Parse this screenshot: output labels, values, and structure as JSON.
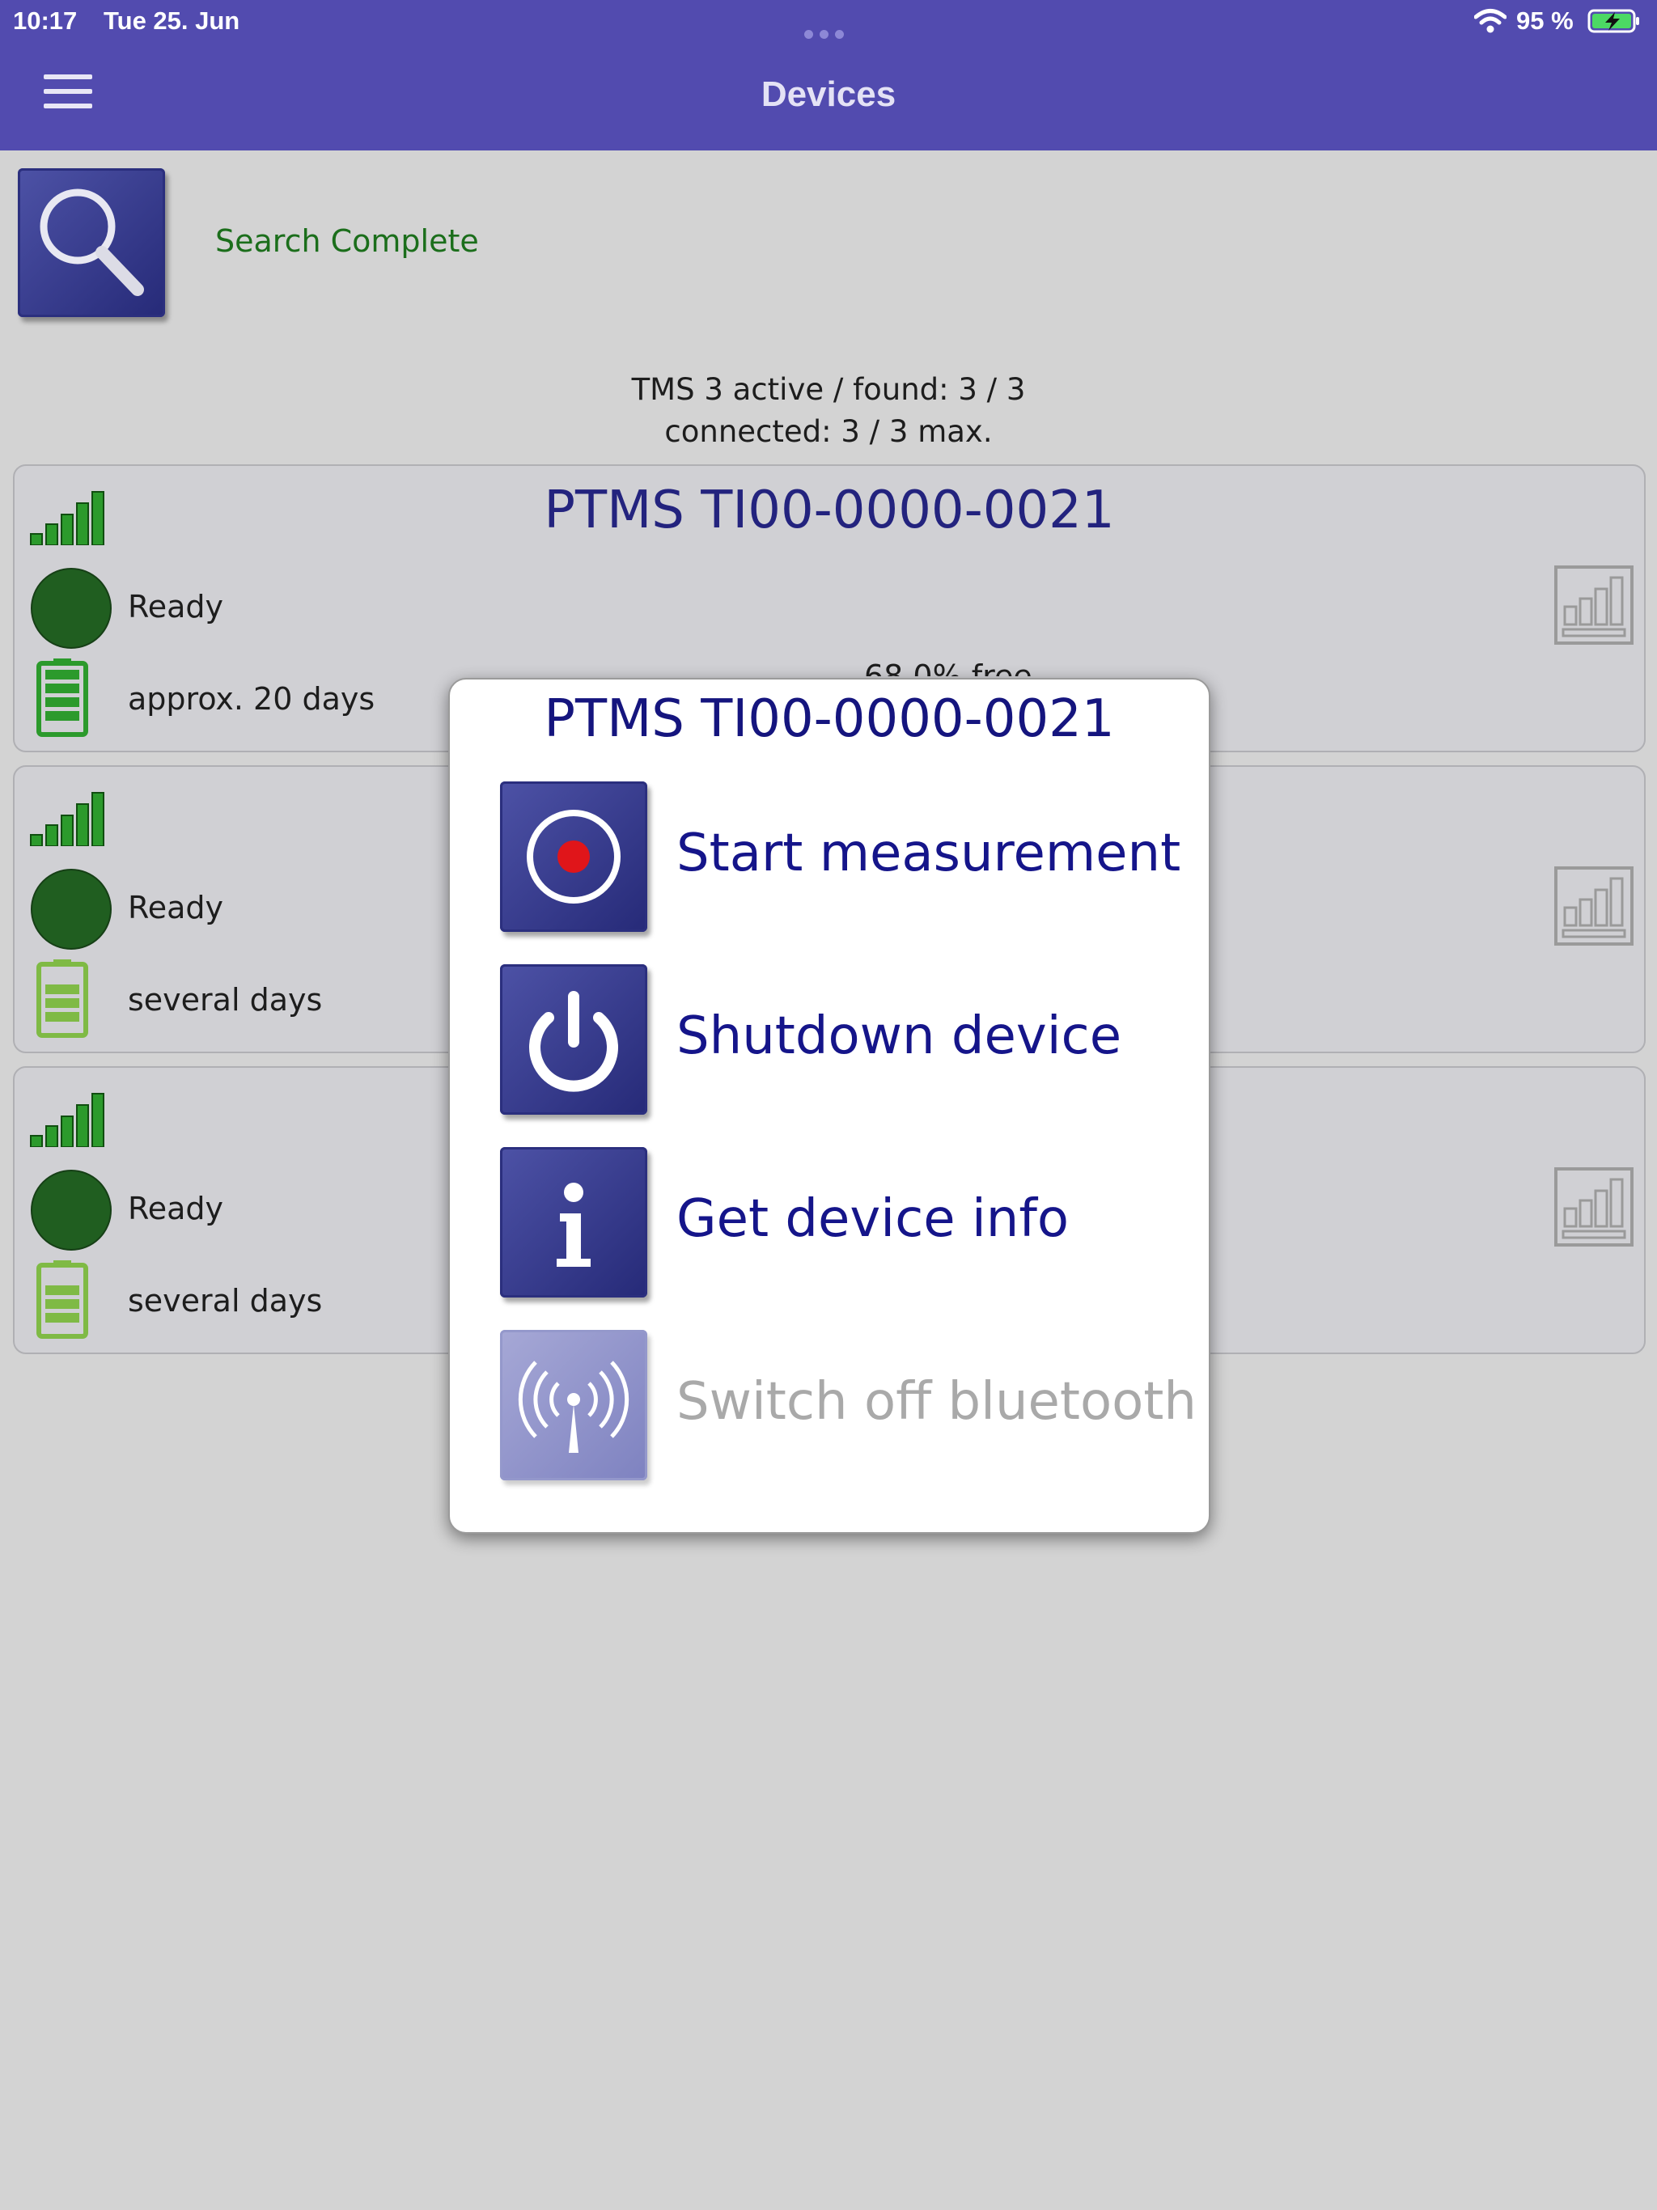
{
  "status_bar": {
    "time": "10:17",
    "date": "Tue 25. Jun",
    "battery_percent": "95 %"
  },
  "nav": {
    "title": "Devices"
  },
  "search": {
    "status": "Search Complete"
  },
  "summary": {
    "line1": "TMS 3 active / found: 3 / 3",
    "line2": "connected: 3 / 3 max."
  },
  "devices": [
    {
      "name": "PTMS TI00-0000-0021",
      "status": "Ready",
      "battery": "approx. 20 days",
      "memory": "68.0% free",
      "battery_level": 1.0
    },
    {
      "name": "",
      "status": "Ready",
      "battery": "several days",
      "battery_level": 0.6
    },
    {
      "name": "",
      "status": "Ready",
      "battery": "several days",
      "battery_level": 0.6
    }
  ],
  "modal": {
    "title": "PTMS TI00-0000-0021",
    "actions": [
      {
        "label": "Start measurement",
        "icon": "record-icon",
        "enabled": true
      },
      {
        "label": "Shutdown device",
        "icon": "power-icon",
        "enabled": true
      },
      {
        "label": "Get device info",
        "icon": "info-icon",
        "enabled": true
      },
      {
        "label": "Switch off bluetooth",
        "icon": "bluetooth-antenna-icon",
        "enabled": false
      }
    ]
  },
  "colors": {
    "header": "#524baf",
    "accent_green": "#1b6e1b",
    "dark_blue": "#15158a",
    "background": "#d3d3d3"
  }
}
